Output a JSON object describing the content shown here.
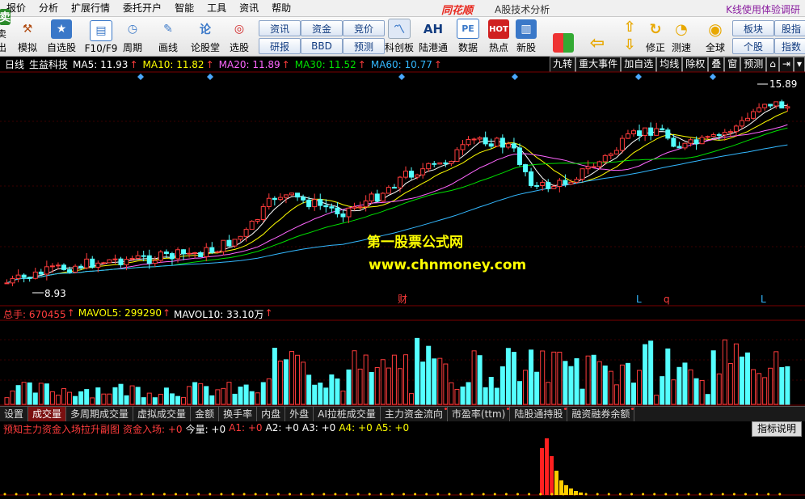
{
  "menu": {
    "items": [
      "报价",
      "分析",
      "扩展行情",
      "委托开户",
      "智能",
      "工具",
      "资讯",
      "帮助"
    ],
    "logo": "同花顺",
    "window_title": "A股技术分析",
    "right_link": "K线使用体验调研"
  },
  "toolbar": {
    "icons": [
      {
        "label": "卖出",
        "icon": "sell-icon"
      },
      {
        "label": "模拟",
        "icon": "gavel-icon"
      },
      {
        "label": "自选股",
        "icon": "star-icon"
      },
      {
        "label": "F10/F9",
        "icon": "document-icon"
      },
      {
        "label": "周期",
        "icon": "clock-icon"
      },
      {
        "label": "画线",
        "icon": "pencil-icon"
      },
      {
        "label": "论股堂",
        "icon": "chat-icon"
      },
      {
        "label": "选股",
        "icon": "stock-select-icon"
      },
      {
        "label": "科创板",
        "icon": "chart-icon"
      },
      {
        "label": "陆港通",
        "icon": "ah-icon"
      },
      {
        "label": "数据",
        "icon": "pe-icon"
      },
      {
        "label": "热点",
        "icon": "hot-icon"
      },
      {
        "label": "新股",
        "icon": "new-stock-icon"
      },
      {
        "label": "修正",
        "icon": "fix-icon"
      },
      {
        "label": "测速",
        "icon": "speed-icon"
      },
      {
        "label": "全球",
        "icon": "globe-icon"
      }
    ],
    "buttons": [
      "资讯",
      "研报",
      "资金",
      "BBD",
      "竞价",
      "预测",
      "板块",
      "个股",
      "股指",
      "指数"
    ],
    "ah_label": "AH",
    "pe_label": "PE"
  },
  "info": {
    "period": "日线",
    "stock": "生益科技",
    "ma5": "MA5: 11.93",
    "ma10": "MA10: 11.82",
    "ma20": "MA20: 11.89",
    "ma30": "MA30: 11.52",
    "ma60": "MA60: 10.77"
  },
  "right_tabs": [
    "九转",
    "重大事件",
    "加自选",
    "均线",
    "除权",
    "叠",
    "窗",
    "预测"
  ],
  "price_labels": {
    "high": "15.89",
    "low": "8.93"
  },
  "markers": {
    "cai": "财",
    "l1": "L",
    "q": "q",
    "l2": "L"
  },
  "volume": {
    "total": "总手: 670455",
    "mavol5": "MAVOL5: 299290",
    "mavol10": "MAVOL10: 33.10万"
  },
  "tabs": [
    "设置",
    "成交量",
    "多周期成交量",
    "虚拟成交量",
    "金额",
    "换手率",
    "内盘",
    "外盘",
    "AI拉桩成交量",
    "主力资金流向",
    "市盈率(ttm)",
    "陆股通持股",
    "融资融券余额"
  ],
  "indicator": {
    "title": "预知主力资金入场拉升副图",
    "inflow": "资金入场: +0",
    "qty": "今量: +0",
    "a1": "A1: +0",
    "a2": "A2: +0",
    "a3": "A3: +0",
    "a4": "A4: +0",
    "a5": "A5: +0",
    "explain_button": "指标说明"
  },
  "watermark": {
    "line1": "第一股票公式网",
    "line2": "www.chnmoney.com"
  },
  "colors": {
    "up": "#ff3c3c",
    "down": "#54ffff",
    "ma5": "#ffffff",
    "ma10": "#ffff00",
    "ma20": "#ff66ff",
    "ma30": "#00e000",
    "ma60": "#33b8ff"
  }
}
